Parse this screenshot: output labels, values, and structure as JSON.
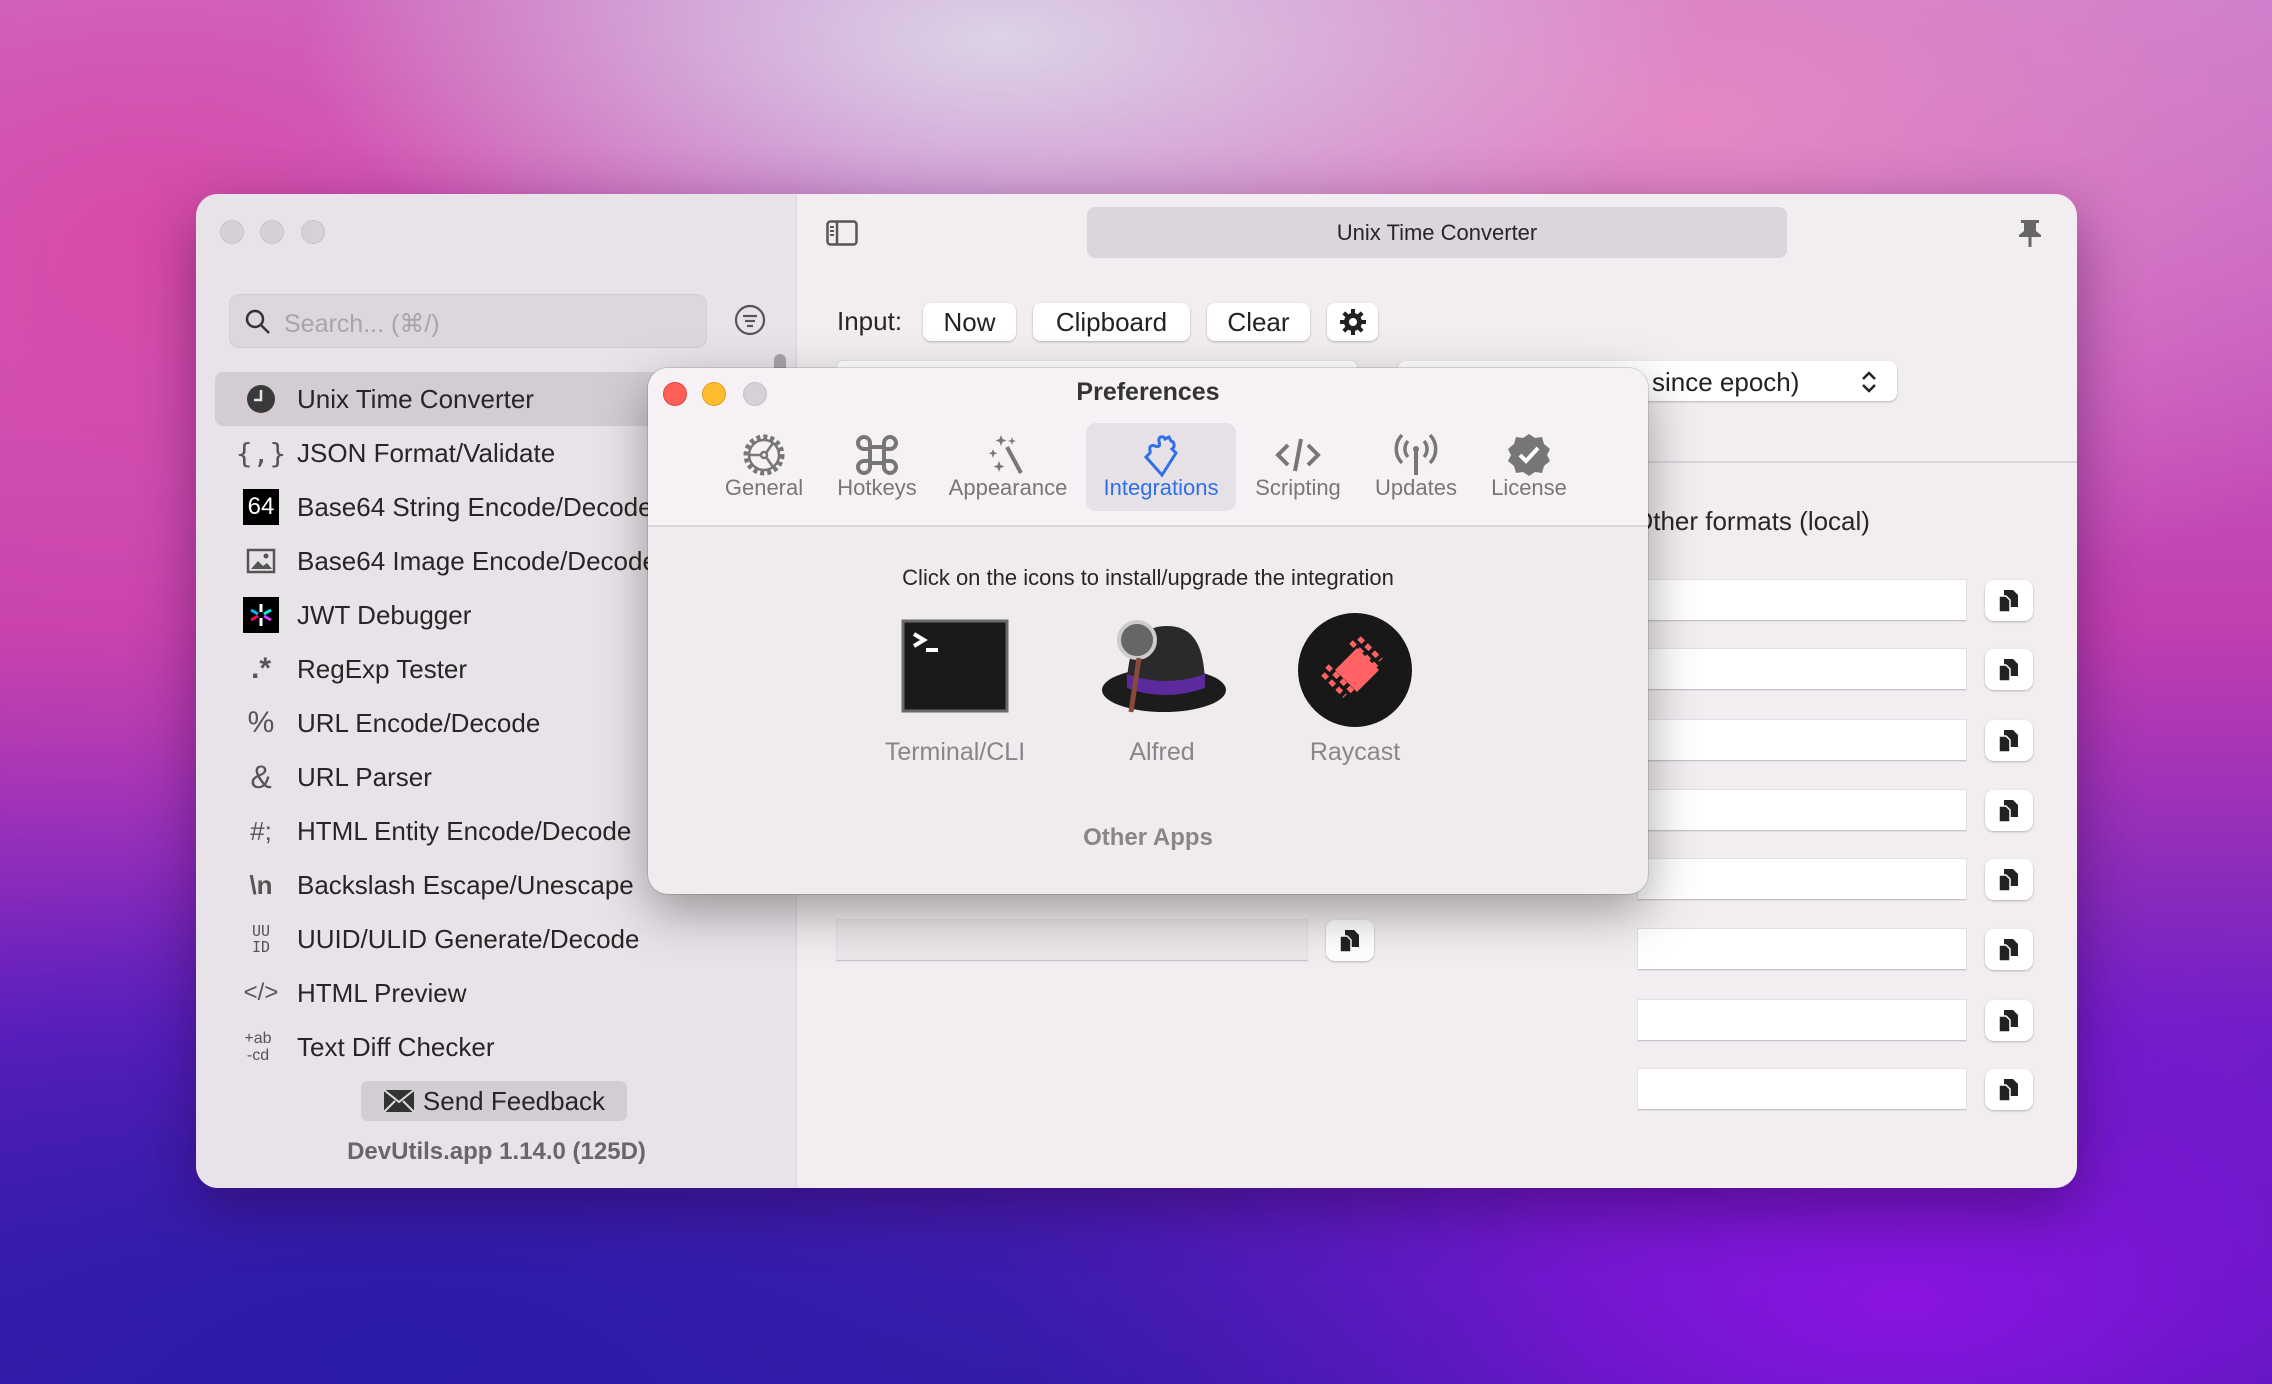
{
  "window": {
    "title": "Unix Time Converter"
  },
  "sidebar": {
    "search_placeholder": "Search... (⌘/)",
    "items": [
      {
        "label": "Unix Time Converter",
        "icon": "clock-icon",
        "selected": true
      },
      {
        "label": "JSON Format/Validate",
        "icon": "braces-icon"
      },
      {
        "label": "Base64 String Encode/Decode",
        "icon": "base64-icon",
        "icon_text": "64"
      },
      {
        "label": "Base64 Image Encode/Decode",
        "icon": "image-icon"
      },
      {
        "label": "JWT Debugger",
        "icon": "jwt-icon"
      },
      {
        "label": "RegExp Tester",
        "icon": "regex-icon",
        "icon_text": ".*"
      },
      {
        "label": "URL Encode/Decode",
        "icon": "percent-icon",
        "icon_text": "%"
      },
      {
        "label": "URL Parser",
        "icon": "ampersand-icon",
        "icon_text": "&"
      },
      {
        "label": "HTML Entity Encode/Decode",
        "icon": "hash-semicolon-icon",
        "icon_text": "#;"
      },
      {
        "label": "Backslash Escape/Unescape",
        "icon": "backslash-n-icon",
        "icon_text": "\\n"
      },
      {
        "label": "UUID/ULID Generate/Decode",
        "icon": "uuid-icon",
        "icon_text": "UU ID"
      },
      {
        "label": "HTML Preview",
        "icon": "code-icon",
        "icon_text": "</>"
      },
      {
        "label": "Text Diff Checker",
        "icon": "diff-icon",
        "icon_text": "+ab -cd"
      }
    ],
    "feedback_label": "Send Feedback",
    "version": "DevUtils.app 1.14.0 (125D)"
  },
  "main": {
    "input_label": "Input:",
    "buttons": {
      "now": "Now",
      "clipboard": "Clipboard",
      "clear": "Clear"
    },
    "format_select": "since epoch)",
    "other_formats_label": "Other formats (local)"
  },
  "preferences": {
    "title": "Preferences",
    "tabs": [
      {
        "label": "General",
        "icon": "gear-icon"
      },
      {
        "label": "Hotkeys",
        "icon": "command-icon"
      },
      {
        "label": "Appearance",
        "icon": "magic-wand-icon"
      },
      {
        "label": "Integrations",
        "icon": "puzzle-icon",
        "selected": true
      },
      {
        "label": "Scripting",
        "icon": "code-icon"
      },
      {
        "label": "Updates",
        "icon": "antenna-icon"
      },
      {
        "label": "License",
        "icon": "checkmark-seal-icon"
      }
    ],
    "instruction": "Click on the icons to install/upgrade the integration",
    "apps": [
      {
        "label": "Terminal/CLI"
      },
      {
        "label": "Alfred"
      },
      {
        "label": "Raycast"
      }
    ],
    "other_apps": "Other Apps",
    "accent": "#2f6fe8"
  }
}
